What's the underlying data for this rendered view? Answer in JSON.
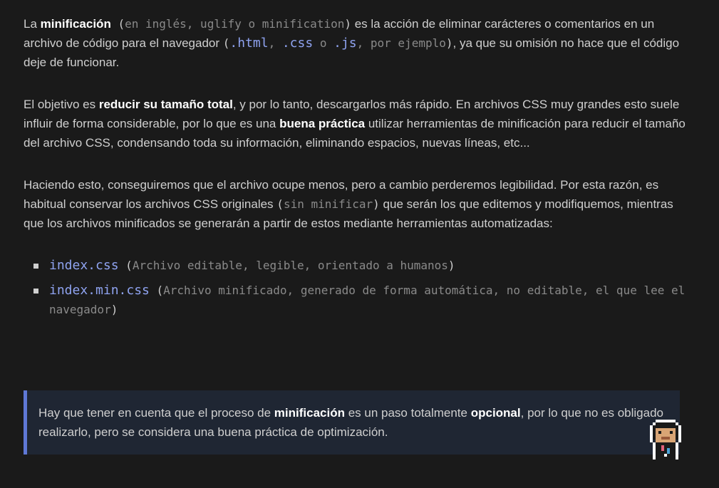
{
  "p1": {
    "t1": "La ",
    "b1": "minificación",
    "paren_open": " (",
    "m1": "en inglés, uglify o minification",
    "paren_close": ")",
    "t2": " es la acción de eliminar carácteres o comentarios en un archivo de código para el navegador ",
    "paren2_open": "(",
    "c1": ".html",
    "m2": ", ",
    "c2": ".css",
    "m3": " o ",
    "c3": ".js",
    "m4": ", por ejemplo",
    "paren2_close": ")",
    "t3": ", ya que su omisión no hace que el código deje de funcionar."
  },
  "p2": {
    "t1": "El objetivo es ",
    "b1": "reducir su tamaño total",
    "t2": ", y por lo tanto, descargarlos más rápido. En archivos CSS muy grandes esto suele influir de forma considerable, por lo que es una ",
    "b2": "buena práctica",
    "t3": " utilizar herramientas de minificación para reducir el tamaño del archivo CSS, condensando toda su información, eliminando espacios, nuevas líneas, etc..."
  },
  "p3": {
    "t1": "Haciendo esto, conseguiremos que el archivo ocupe menos, pero a cambio perderemos legibilidad. Por esta razón, es habitual conservar los archivos CSS originales ",
    "paren_open": "(",
    "m1": "sin minificar",
    "paren_close": ")",
    "t2": " que serán los que editemos y modifiquemos, mientras que los archivos minificados se generarán a partir de estos mediante herramientas automatizadas:"
  },
  "list": [
    {
      "code": "index.css",
      "open": " (",
      "desc": "Archivo editable, legible, orientado a humanos",
      "close": ")"
    },
    {
      "code": "index.min.css",
      "open": " (",
      "desc": "Archivo minificado, generado de forma automática, no editable, el que lee el navegador",
      "close": ")"
    }
  ],
  "note": {
    "t1": "Hay que tener en cuenta que el proceso de ",
    "b1": "minificación",
    "t2": " es un paso totalmente ",
    "b2": "opcional",
    "t3": ", por lo que no es obligado realizarlo, pero se considera una buena práctica de optimización."
  },
  "icons": {
    "avatar": "pixel-avatar-icon"
  }
}
